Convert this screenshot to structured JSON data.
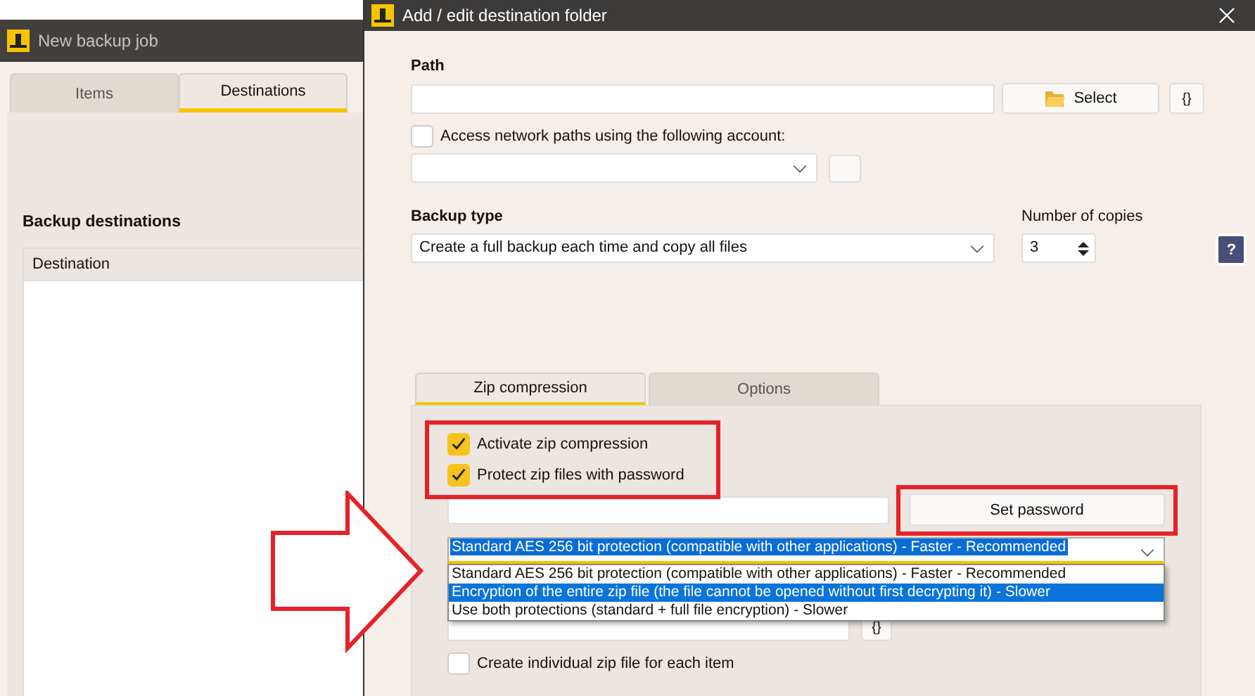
{
  "background_window": {
    "title": "New backup job",
    "tabs": [
      {
        "label": "Items",
        "selected": false
      },
      {
        "label": "Destinations",
        "selected": true
      }
    ],
    "section_title": "Backup destinations",
    "table": {
      "columns": [
        "Destination"
      ]
    }
  },
  "dialog": {
    "title": "Add / edit destination folder",
    "path_label": "Path",
    "select_button": "Select",
    "variables_button": "{}",
    "network_account": {
      "label": "Access network paths using the following account:",
      "checked": false
    },
    "backup_type_label": "Backup type",
    "backup_type": "Create a full backup each time and copy all files",
    "copies_label": "Number of copies",
    "copies": "3",
    "help_button": "?",
    "tabs": [
      {
        "label": "Zip compression",
        "selected": true
      },
      {
        "label": "Options",
        "selected": false
      }
    ],
    "zip_options": [
      {
        "label": "Activate zip compression",
        "checked": true
      },
      {
        "label": "Protect zip files with password",
        "checked": true
      }
    ],
    "set_password_button": "Set password",
    "encryption": "Standard AES 256 bit protection (compatible with other applications) - Faster - Recommended",
    "encryption_options": [
      {
        "label": "Standard AES 256 bit protection (compatible with other applications) - Faster - Recommended",
        "selected": false
      },
      {
        "label": "Encryption of the entire zip file (the file cannot be opened without first decrypting it) - Slower",
        "selected": true
      },
      {
        "label": "Use both protections (standard + full file encryption) - Slower",
        "selected": false
      }
    ],
    "variables_button_2": "{}",
    "individual_zip": {
      "label": "Create individual zip file for each item",
      "checked": false
    }
  }
}
